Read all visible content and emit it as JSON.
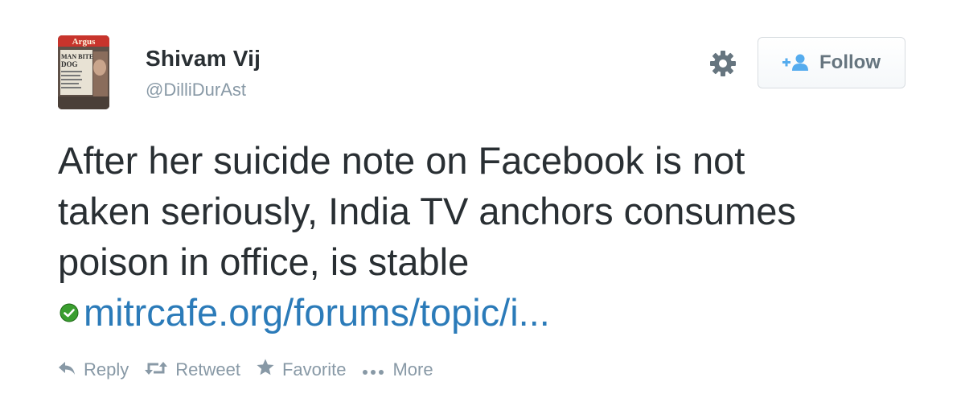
{
  "author": {
    "fullname": "Shivam Vij",
    "handle": "@DilliDurAst",
    "avatar_text": [
      "Argus",
      "MAN BITES",
      "DOG"
    ]
  },
  "header": {
    "gear_icon": "gear-icon",
    "follow_label": "Follow",
    "follow_icon": "add-user-icon"
  },
  "tweet": {
    "lines": [
      "After her suicide note on Facebook is not",
      "taken seriously, India TV anchors consumes",
      "poison in office, is stable"
    ],
    "link_text": "mitrcafe.org/forums/topic/i...",
    "link_icon": "verified-link-icon"
  },
  "actions": [
    {
      "label": "Reply",
      "icon": "reply-icon"
    },
    {
      "label": "Retweet",
      "icon": "retweet-icon"
    },
    {
      "label": "Favorite",
      "icon": "star-icon"
    },
    {
      "label": "More",
      "icon": "more-dots-icon"
    }
  ],
  "colors": {
    "text": "#292f33",
    "secondary": "#8899a6",
    "link": "#2b7bb9",
    "follow_icon": "#55acee",
    "link_icon_green": "#3a9e2f"
  }
}
